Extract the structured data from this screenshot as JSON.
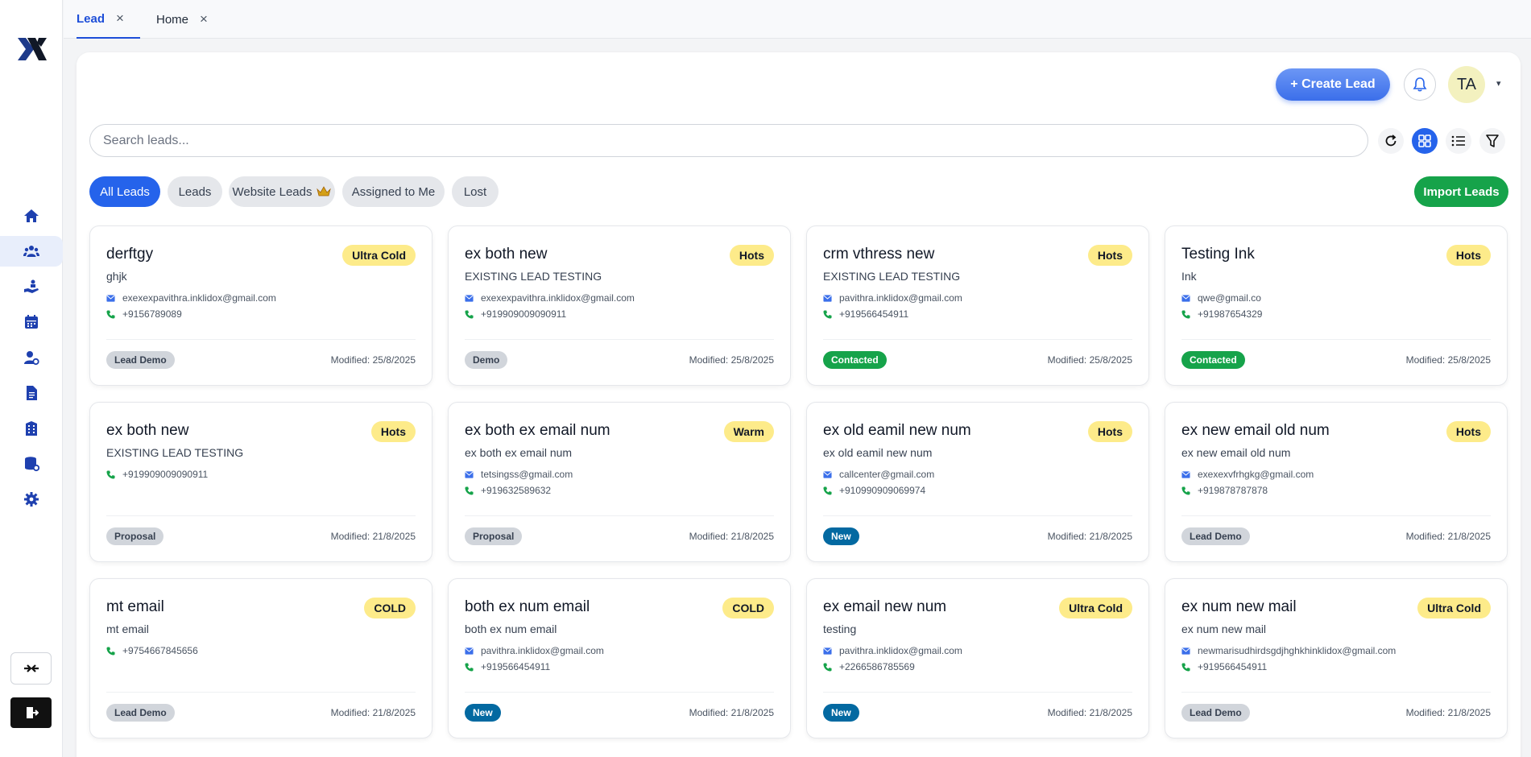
{
  "tabs": [
    {
      "label": "Lead",
      "active": true
    },
    {
      "label": "Home",
      "active": false
    }
  ],
  "tab_close_glyph": "×",
  "sidebar": {
    "icons": [
      "home-icon",
      "users-icon",
      "hand-holding-icon",
      "calendar-icon",
      "user-gear-icon",
      "document-icon",
      "building-icon",
      "database-gear-icon",
      "settings-icon"
    ],
    "active_index": 1
  },
  "header": {
    "create_label": "+ Create Lead",
    "avatar_initials": "TA",
    "avatar_caret": "▾"
  },
  "search": {
    "placeholder": "Search leads..."
  },
  "filters": [
    {
      "label": "All Leads",
      "active": true
    },
    {
      "label": "Leads",
      "active": false
    },
    {
      "label": "Website Leads",
      "active": false,
      "crown": true
    },
    {
      "label": "Assigned to Me",
      "active": false
    },
    {
      "label": "Lost",
      "active": false
    }
  ],
  "import_label": "Import Leads",
  "colors": {
    "accent": "#2563eb",
    "success": "#16a34a",
    "badge": "#fdeb8a",
    "info": "#0369a1"
  },
  "leads": [
    {
      "name": "derftgy",
      "sub": "ghjk",
      "email": "exexexpavithra.inklidox@gmail.com",
      "phone": "+9156789089",
      "temp": "Ultra Cold",
      "status": "Lead Demo",
      "status_style": "gray",
      "modified": "Modified: 25/8/2025"
    },
    {
      "name": "ex both new",
      "sub": "EXISTING LEAD TESTING",
      "email": "exexexpavithra.inklidox@gmail.com",
      "phone": "+919909009090911",
      "temp": "Hots",
      "status": "Demo",
      "status_style": "gray",
      "modified": "Modified: 25/8/2025"
    },
    {
      "name": "crm vthress new",
      "sub": "EXISTING LEAD TESTING",
      "email": "pavithra.inklidox@gmail.com",
      "phone": "+919566454911",
      "temp": "Hots",
      "status": "Contacted",
      "status_style": "green",
      "modified": "Modified: 25/8/2025"
    },
    {
      "name": "Testing Ink",
      "sub": "Ink",
      "email": "qwe@gmail.co",
      "phone": "+91987654329",
      "temp": "Hots",
      "status": "Contacted",
      "status_style": "green",
      "modified": "Modified: 25/8/2025"
    },
    {
      "name": "ex both new",
      "sub": "EXISTING LEAD TESTING",
      "email": "",
      "phone": "+919909009090911",
      "temp": "Hots",
      "status": "Proposal",
      "status_style": "gray",
      "modified": "Modified: 21/8/2025"
    },
    {
      "name": "ex both ex email num",
      "sub": "ex both ex email num",
      "email": "tetsingss@gmail.com",
      "phone": "+919632589632",
      "temp": "Warm",
      "status": "Proposal",
      "status_style": "gray",
      "modified": "Modified: 21/8/2025"
    },
    {
      "name": "ex old eamil new num",
      "sub": "ex old eamil new num",
      "email": "callcenter@gmail.com",
      "phone": "+910990909069974",
      "temp": "Hots",
      "status": "New",
      "status_style": "blue",
      "modified": "Modified: 21/8/2025"
    },
    {
      "name": "ex new email old num",
      "sub": "ex new email old num",
      "email": "exexexvfrhgkg@gmail.com",
      "phone": "+919878787878",
      "temp": "Hots",
      "status": "Lead Demo",
      "status_style": "gray",
      "modified": "Modified: 21/8/2025"
    },
    {
      "name": "mt email",
      "sub": "mt email",
      "email": "",
      "phone": "+9754667845656",
      "temp": "COLD",
      "status": "Lead Demo",
      "status_style": "gray",
      "modified": "Modified: 21/8/2025"
    },
    {
      "name": "both ex num email",
      "sub": "both ex num email",
      "email": "pavithra.inklidox@gmail.com",
      "phone": "+919566454911",
      "temp": "COLD",
      "status": "New",
      "status_style": "blue",
      "modified": "Modified: 21/8/2025"
    },
    {
      "name": "ex email new num",
      "sub": "testing",
      "email": "pavithra.inklidox@gmail.com",
      "phone": "+2266586785569",
      "temp": "Ultra Cold",
      "status": "New",
      "status_style": "blue",
      "modified": "Modified: 21/8/2025"
    },
    {
      "name": "ex num new mail",
      "sub": "ex num new mail",
      "email": "newmarisudhirdsgdjhghkhinklidox@gmail.com",
      "phone": "+919566454911",
      "temp": "Ultra Cold",
      "status": "Lead Demo",
      "status_style": "gray",
      "modified": "Modified: 21/8/2025"
    }
  ]
}
